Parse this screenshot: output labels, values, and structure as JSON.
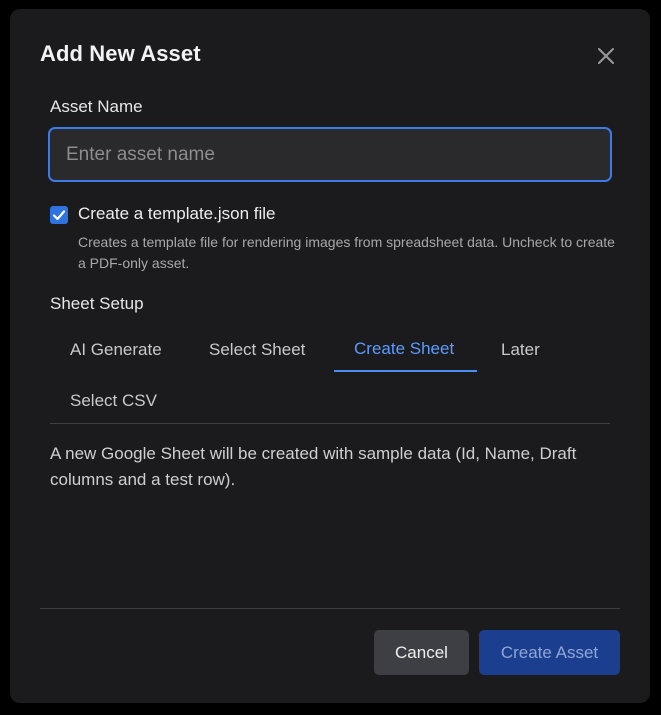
{
  "dialog": {
    "title": "Add New Asset",
    "close_icon": "close-icon"
  },
  "asset_name": {
    "label": "Asset Name",
    "value": "",
    "placeholder": "Enter asset name"
  },
  "template_option": {
    "checked": true,
    "label": "Create a template.json file",
    "help": "Creates a template file for rendering images from spreadsheet data. Uncheck to create a PDF-only asset."
  },
  "sheet_setup": {
    "label": "Sheet Setup",
    "tabs": [
      {
        "label": "AI Generate",
        "active": false
      },
      {
        "label": "Select Sheet",
        "active": false
      },
      {
        "label": "Create Sheet",
        "active": true
      },
      {
        "label": "Later",
        "active": false
      },
      {
        "label": "Select CSV",
        "active": false
      }
    ],
    "description": "A new Google Sheet will be created with sample data (Id, Name, Draft columns and a test row)."
  },
  "footer": {
    "cancel_label": "Cancel",
    "create_label": "Create Asset"
  },
  "colors": {
    "accent": "#3b7ce8",
    "active_tab": "#5a9bff",
    "primary_button": "#1b3f8e",
    "dialog_background": "#1b1b1d"
  }
}
